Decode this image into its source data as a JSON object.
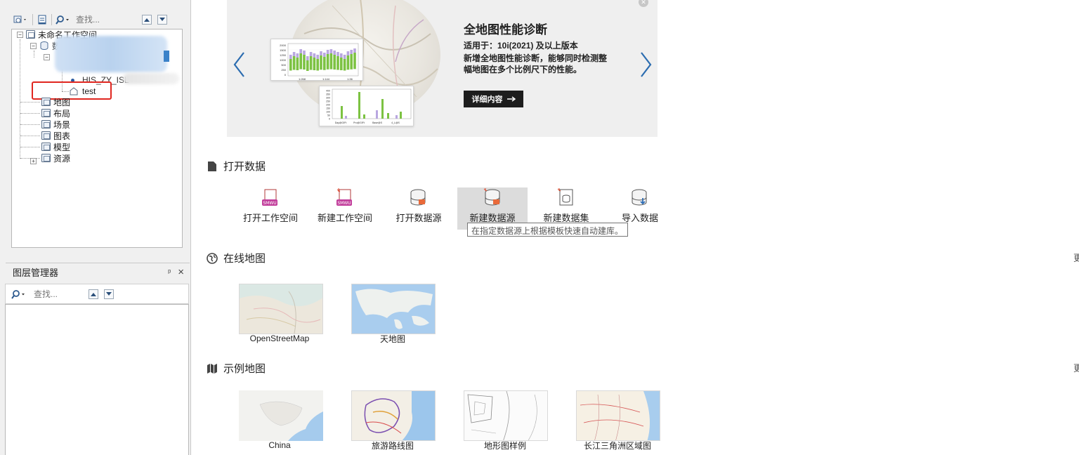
{
  "workspace_panel": {
    "search_placeholder": "查找...",
    "tree": {
      "workspace_label": "未命名工作空间",
      "datasources_label": "数",
      "dataset_1_label": "HIS_ZY_ISL",
      "dataset_2_label": "test",
      "nodes": [
        {
          "label": "地图",
          "icon": "map-folder-icon"
        },
        {
          "label": "布局",
          "icon": "layout-folder-icon"
        },
        {
          "label": "场景",
          "icon": "scene-folder-icon"
        },
        {
          "label": "图表",
          "icon": "chart-folder-icon"
        },
        {
          "label": "模型",
          "icon": "model-folder-icon"
        },
        {
          "label": "资源",
          "icon": "resource-folder-icon"
        }
      ]
    }
  },
  "layer_panel": {
    "title": "图层管理器",
    "pin_glyph": "ᵖ",
    "close_glyph": "×",
    "search_placeholder": "查找..."
  },
  "banner": {
    "title": "全地图性能诊断",
    "line1": "适用于：10i(2021) 及以上版本",
    "line2": "新增全地图性能诊断，能够同时检测整",
    "line3": "幅地图在多个比例尺下的性能。",
    "detail_button": "详细内容",
    "chart_ticks_top": [
      "1:268",
      "1:144",
      "1:36"
    ],
    "chart_y_ticks_top": [
      "2000",
      "1500",
      "1250",
      "1000",
      "500",
      "250",
      "0"
    ],
    "chart_y_ticks_bottom": [
      "400",
      "350",
      "300",
      "250",
      "200",
      "150",
      "100",
      "50",
      "0"
    ],
    "chart_cats_bottom": [
      "Day@GIFt",
      "Pro@GIFt",
      "Base@S",
      "4_L@S"
    ]
  },
  "open_data": {
    "title": "打开数据",
    "actions": [
      {
        "label": "打开工作空间",
        "icon": "open-workspace-icon"
      },
      {
        "label": "新建工作空间",
        "icon": "new-workspace-icon"
      },
      {
        "label": "打开数据源",
        "icon": "open-datasource-icon"
      },
      {
        "label": "新建数据源",
        "icon": "new-datasource-icon"
      },
      {
        "label": "新建数据集",
        "icon": "new-dataset-icon"
      },
      {
        "label": "导入数据",
        "icon": "import-data-icon"
      }
    ],
    "tooltip": "在指定数据源上根据模板快速自动建库。"
  },
  "online_maps": {
    "title": "在线地图",
    "more": "更",
    "items": [
      {
        "label": "OpenStreetMap"
      },
      {
        "label": "天地图"
      }
    ]
  },
  "sample_maps": {
    "title": "示例地图",
    "more": "更",
    "items": [
      {
        "label": "China"
      },
      {
        "label": "旅游路线图"
      },
      {
        "label": "地形图样例"
      },
      {
        "label": "长江三角洲区域图"
      }
    ]
  },
  "colors": {
    "accent_blue": "#2b6cb0",
    "highlight_red": "#e0261f",
    "chart_green": "#7cc242",
    "chart_lavender": "#b9a7e0"
  }
}
